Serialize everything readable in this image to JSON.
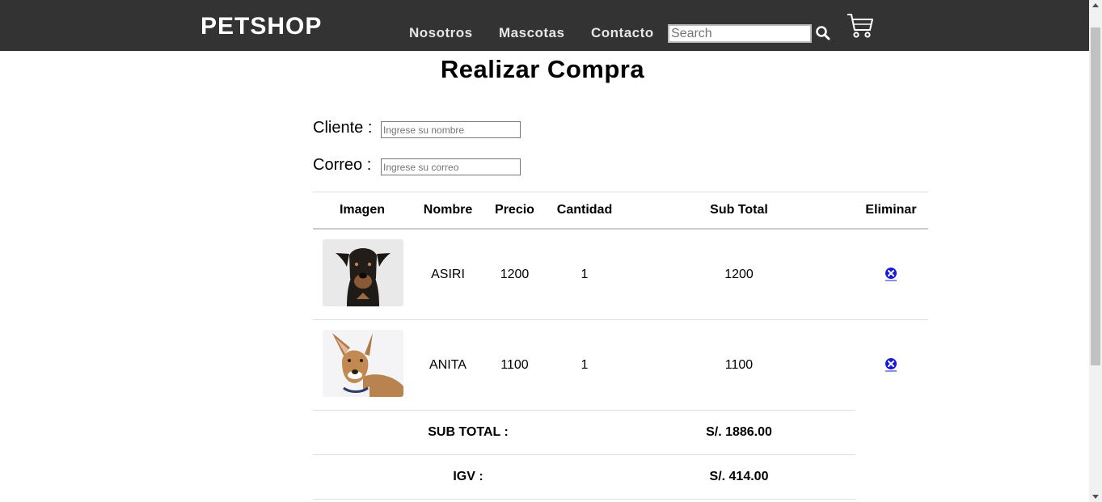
{
  "navbar": {
    "brand": "PETSHOP",
    "links": [
      "Nosotros",
      "Mascotas",
      "Contacto"
    ],
    "search_placeholder": "Search"
  },
  "page": {
    "title": "Realizar Compra",
    "cliente_label": "Cliente :",
    "cliente_placeholder": "Ingrese su nombre",
    "correo_label": "Correo :",
    "correo_placeholder": "Ingrese su correo"
  },
  "table": {
    "headers": [
      "Imagen",
      "Nombre",
      "Precio",
      "Cantidad",
      "Sub Total",
      "Eliminar"
    ],
    "rows": [
      {
        "nombre": "ASIRI",
        "precio": "1200",
        "cantidad": "1",
        "subtotal": "1200"
      },
      {
        "nombre": "ANITA",
        "precio": "1100",
        "cantidad": "1",
        "subtotal": "1100"
      }
    ]
  },
  "totals": {
    "subtotal_label": "SUB TOTAL :",
    "subtotal_value": "S/. 1886.00",
    "igv_label": "IGV :",
    "igv_value": "S/. 414.00"
  },
  "colors": {
    "navbar": "#333333",
    "delete_icon": "#1a1adb",
    "divider": "#dddddd"
  }
}
